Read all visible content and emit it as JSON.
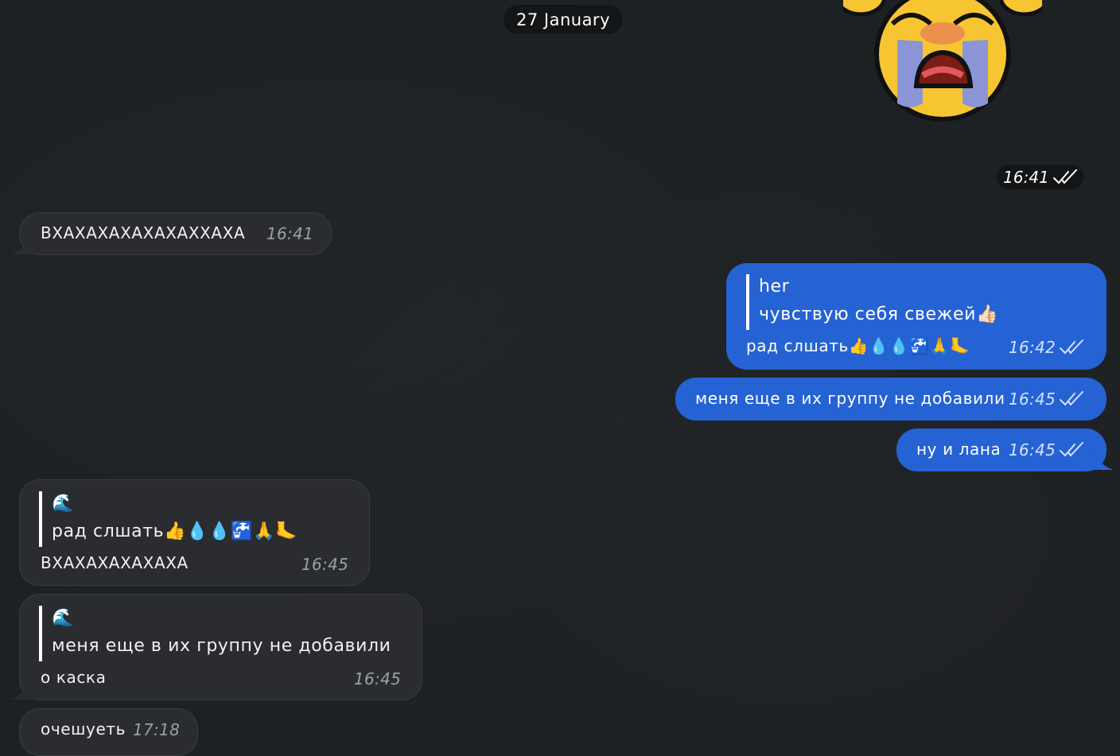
{
  "date_separator": "27 January",
  "sticker": {
    "time": "16:41"
  },
  "messages": [
    {
      "text": "ВХАХАХАХАХАХАХХАХА",
      "time": "16:41"
    },
    {
      "reply_name": "her",
      "reply_text": "чувствую себя свежей👍🏻",
      "text": "рад слшать👍💧💧🚰🙏🦶",
      "time": "16:42"
    },
    {
      "text": "меня еще в их группу не добавили",
      "time": "16:45"
    },
    {
      "text": "ну и лана",
      "time": "16:45"
    },
    {
      "reply_name": "🌊",
      "reply_text": "рад слшать👍💧💧🚰🙏🦶",
      "text": "ВХАХАХАХАХАХА",
      "time": "16:45"
    },
    {
      "reply_name": "🌊",
      "reply_text": "меня еще в их группу не добавили",
      "text": "о каска",
      "time": "16:45"
    },
    {
      "text": "очешуеть",
      "time": "17:18"
    }
  ],
  "colors": {
    "background": "#1e2124",
    "outgoing": "#2563d4",
    "incoming": "#2b2c2f"
  },
  "icons": {
    "read_status": "double-check-icon"
  }
}
